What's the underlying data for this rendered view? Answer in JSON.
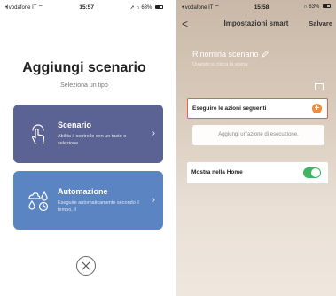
{
  "left": {
    "status": {
      "carrier": "vodafone IT",
      "time": "15:57",
      "battery": "63%"
    },
    "title": "Aggiungi scenario",
    "subtitle": "Seleziona un tipo",
    "cards": [
      {
        "title": "Scenario",
        "description": "Abilita il controllo con un tasto o selezione",
        "icon": "touch-hand-icon"
      },
      {
        "title": "Automazione",
        "description": "Eseguire automaticamente secondo il tempo, il",
        "icon": "weather-clock-icon"
      }
    ],
    "close_icon": "close-icon"
  },
  "right": {
    "status": {
      "carrier": "vodafone IT",
      "time": "15:58",
      "battery": "63%"
    },
    "nav": {
      "back": "<",
      "title": "Impostazioni smart",
      "save": "Salvare"
    },
    "scene": {
      "name": "Rinomina scenario",
      "hint": "Quando si clicca la scena"
    },
    "actions_label": "Eseguire le azioni seguenti",
    "add_action_label": "Aggiungi un'azione di esecuzione.",
    "home_label": "Mostra nella Home",
    "home_toggle_on": true
  },
  "colors": {
    "scenario_card": "#5a6394",
    "automation_card": "#5a84c2",
    "accent_orange": "#ef8b3a",
    "highlight_red": "#e8604c",
    "toggle_green": "#3fb55f"
  }
}
